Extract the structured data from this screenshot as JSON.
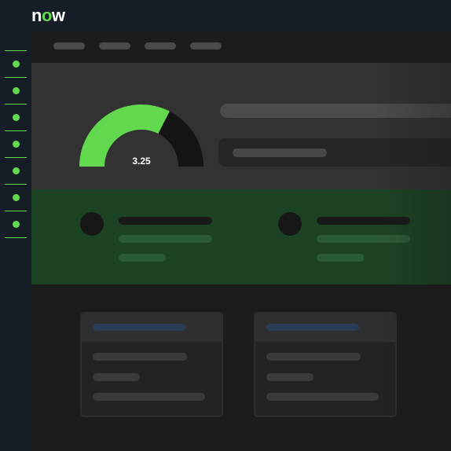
{
  "header": {
    "logo_text_n": "n",
    "logo_text_o": "o",
    "logo_text_w": "w"
  },
  "sidebar": {
    "item_count": 7
  },
  "nav": {
    "pill_count": 4
  },
  "gauge": {
    "value_label": "3.25",
    "fill_fraction": 0.65,
    "fill_color": "#62d84e",
    "track_color": "#141414"
  },
  "colors": {
    "accent": "#62d84e",
    "topbar": "#151e26",
    "band_gray": "#323232",
    "band_green": "#1b4323",
    "card_tag": "#2a3d55"
  },
  "people": [
    {
      "name_placeholder": "",
      "detail_placeholder": ""
    },
    {
      "name_placeholder": "",
      "detail_placeholder": ""
    }
  ],
  "cards": [
    {
      "title_placeholder": ""
    },
    {
      "title_placeholder": ""
    }
  ]
}
